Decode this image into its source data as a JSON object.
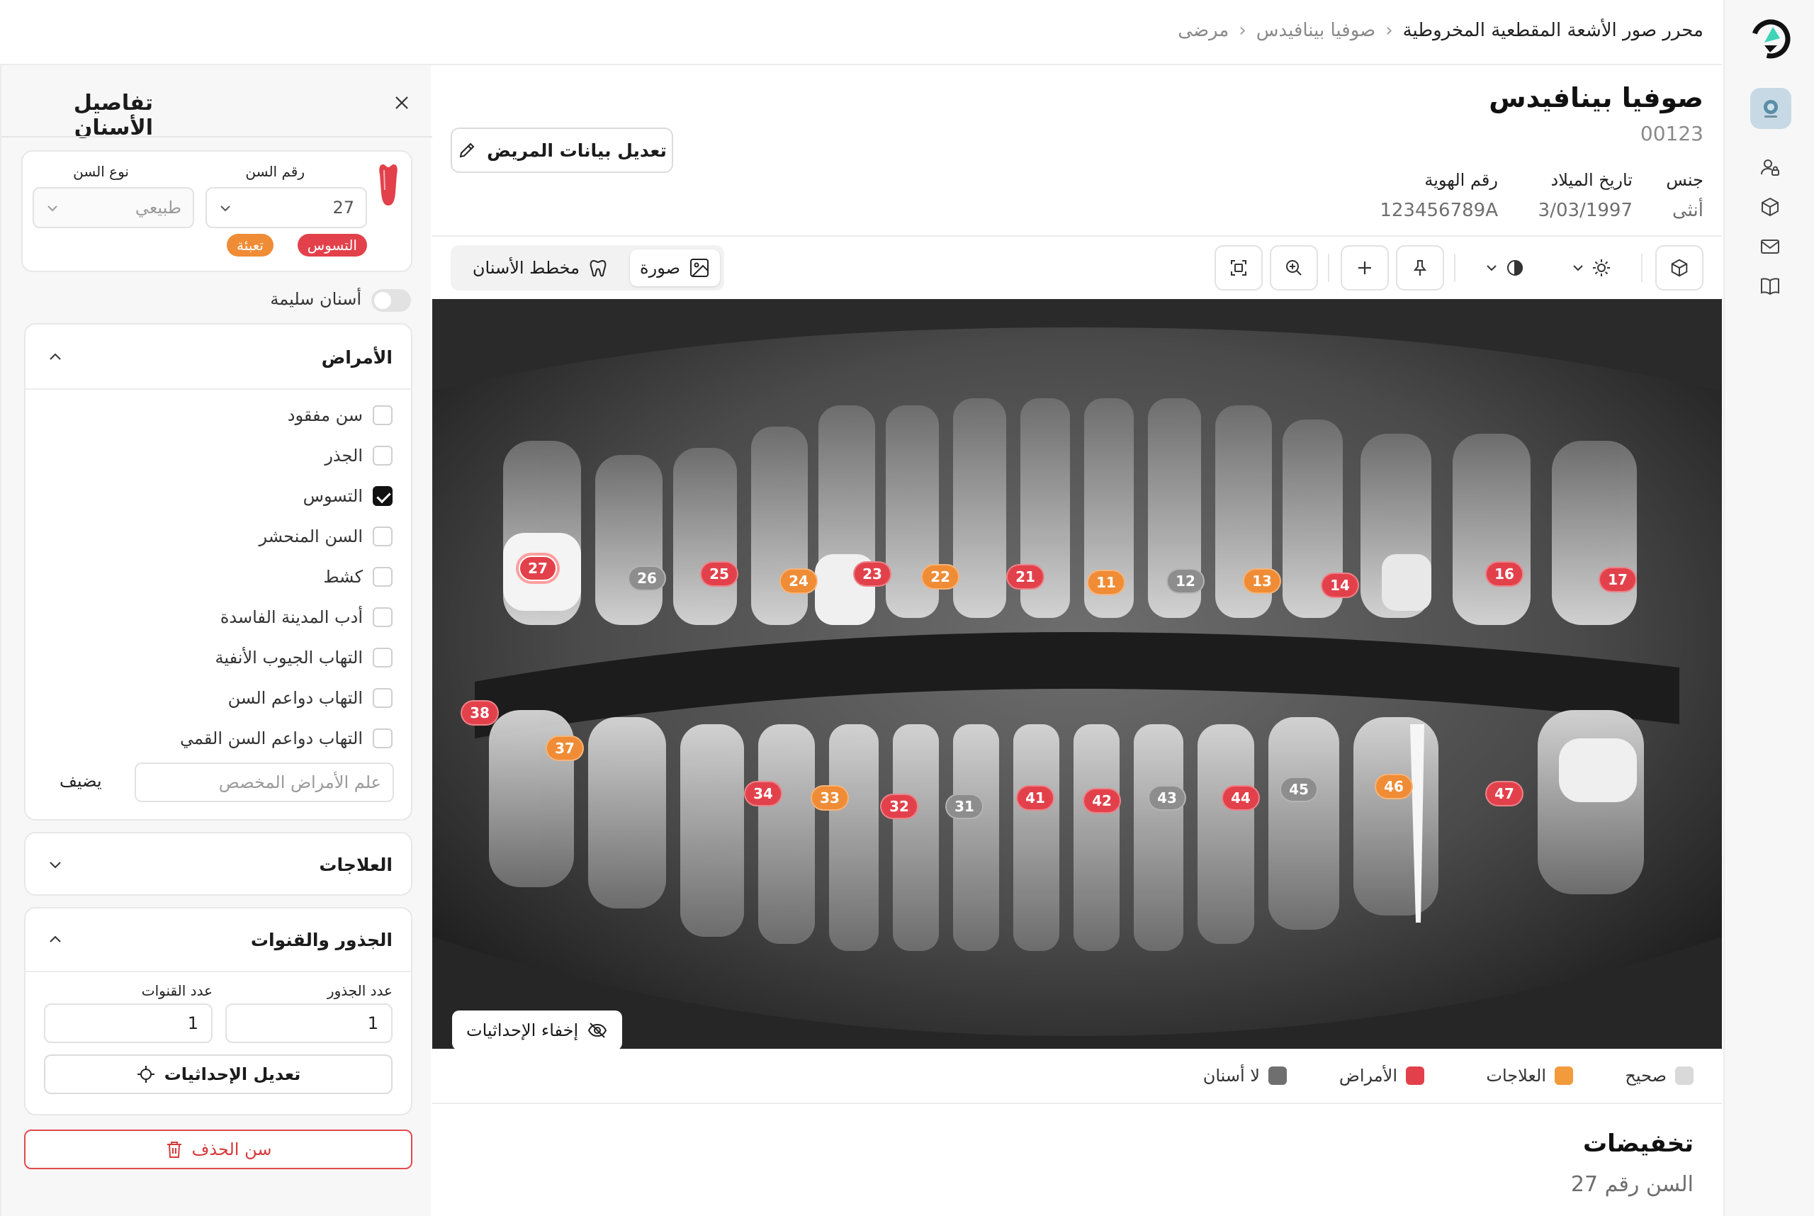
{
  "breadcrumb": [
    "محرر صور الأشعة المقطعية المخروطية",
    "صوفيا بينافيدس",
    "مرضى"
  ],
  "patient": {
    "name": "صوفيا بينافيدس",
    "id": "00123",
    "gender_label": "جنس",
    "gender": "أنثى",
    "dob_label": "تاريخ الميلاد",
    "dob": "3/03/1997",
    "idnum_label": "رقم الهوية",
    "idnum": "123456789A",
    "edit_label": "تعديل بيانات المريض"
  },
  "view_tabs": {
    "image": "صورة",
    "chart": "مخطط الأسنان",
    "active": "image"
  },
  "xray": {
    "hide_label": "إخفاء الإحداثيات",
    "selected": "27",
    "teeth": [
      {
        "n": "27",
        "s": "disease"
      },
      {
        "n": "26",
        "s": "none"
      },
      {
        "n": "25",
        "s": "disease"
      },
      {
        "n": "24",
        "s": "treatment"
      },
      {
        "n": "23",
        "s": "disease"
      },
      {
        "n": "22",
        "s": "treatment"
      },
      {
        "n": "21",
        "s": "disease"
      },
      {
        "n": "11",
        "s": "treatment"
      },
      {
        "n": "12",
        "s": "none"
      },
      {
        "n": "13",
        "s": "treatment"
      },
      {
        "n": "14",
        "s": "disease"
      },
      {
        "n": "16",
        "s": "disease"
      },
      {
        "n": "17",
        "s": "disease"
      },
      {
        "n": "38",
        "s": "disease"
      },
      {
        "n": "37",
        "s": "treatment"
      },
      {
        "n": "34",
        "s": "disease"
      },
      {
        "n": "33",
        "s": "treatment"
      },
      {
        "n": "32",
        "s": "disease"
      },
      {
        "n": "31",
        "s": "none"
      },
      {
        "n": "41",
        "s": "disease"
      },
      {
        "n": "42",
        "s": "disease"
      },
      {
        "n": "43",
        "s": "none"
      },
      {
        "n": "44",
        "s": "disease"
      },
      {
        "n": "45",
        "s": "none"
      },
      {
        "n": "46",
        "s": "treatment"
      },
      {
        "n": "47",
        "s": "disease"
      }
    ]
  },
  "status_colors": {
    "disease": "#e2414b",
    "treatment": "#ef8c35",
    "none": "#8d8d8d",
    "healthy": "#d9d9d9"
  },
  "legend": [
    {
      "label": "صحيح",
      "color": "#d9d9d9"
    },
    {
      "label": "العلاجات",
      "color": "#f39a3c"
    },
    {
      "label": "الأمراض",
      "color": "#e2414b"
    },
    {
      "label": "لا أسنان",
      "color": "#6f6f6f"
    }
  ],
  "notes": {
    "title": "تخفيضات",
    "subtitle": "السن رقم 27"
  },
  "panel": {
    "title": "تفاصيل الأسنان",
    "tooth_number_label": "رقم السن",
    "tooth_number": "27",
    "tooth_type_label": "نوع السن",
    "tooth_type": "طبيعي",
    "badges": [
      {
        "label": "التسوس",
        "color": "#e2414b"
      },
      {
        "label": "تعبئة",
        "color": "#ef8c35"
      }
    ],
    "healthy_toggle_label": "أسنان سليمة",
    "diseases_title": "الأمراض",
    "diseases": [
      {
        "label": "سن مفقود",
        "checked": false
      },
      {
        "label": "الجذر",
        "checked": false
      },
      {
        "label": "التسوس",
        "checked": true
      },
      {
        "label": "السن المنحشر",
        "checked": false
      },
      {
        "label": "كشط",
        "checked": false
      },
      {
        "label": "أدب المدينة الفاسدة",
        "checked": false
      },
      {
        "label": "التهاب الجيوب الأنفية",
        "checked": false
      },
      {
        "label": "التهاب دواعم السن",
        "checked": false
      },
      {
        "label": "التهاب دواعم السن القمي",
        "checked": false
      }
    ],
    "custom_placeholder": "علم الأمراض المخصص",
    "add_label": "يضيف",
    "treatments_title": "العلاجات",
    "roots_title": "الجذور والقنوات",
    "roots_label": "عدد الجذور",
    "roots_value": "1",
    "canals_label": "عدد القنوات",
    "canals_value": "1",
    "edit_coords_label": "تعديل الإحداثيات",
    "delete_label": "سن الحذف"
  }
}
